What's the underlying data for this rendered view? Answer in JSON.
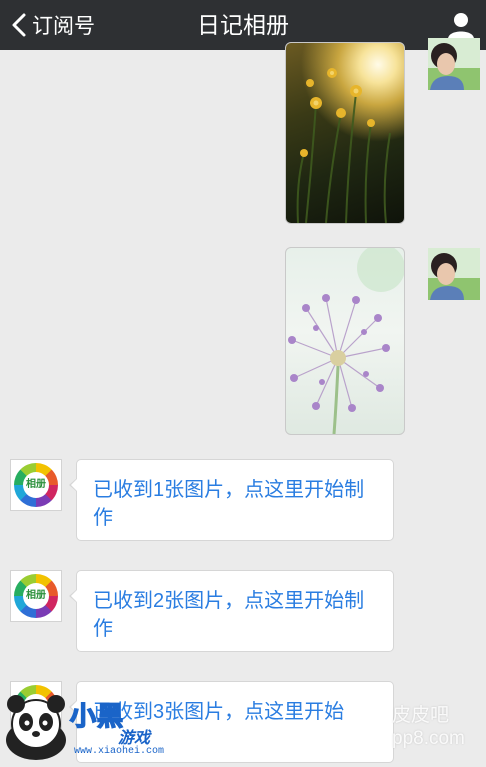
{
  "header": {
    "back_label": "订阅号",
    "title": "日记相册"
  },
  "icons": {
    "back": "chevron-left-icon",
    "profile": "person-icon",
    "app_logo": "album-logo-icon"
  },
  "messages": [
    {
      "type": "image",
      "side": "right",
      "content": "sunlit daffodils photo"
    },
    {
      "type": "image",
      "side": "right",
      "content": "purple allium flower photo"
    },
    {
      "type": "text",
      "side": "left",
      "avatar_text": "相册",
      "text": "已收到1张图片，点这里开始制作"
    },
    {
      "type": "text",
      "side": "left",
      "avatar_text": "相册",
      "text": "已收到2张图片，点这里开始制作"
    },
    {
      "type": "text",
      "side": "left",
      "avatar_text": "相册",
      "text": "已收到3张图片，点这里开始"
    }
  ],
  "watermarks": {
    "site_name": "皮皮吧",
    "site_domain": "pp8.com",
    "brand_text": "小黑",
    "brand_sub": "游戏",
    "brand_url": "www.xiaohei.com"
  },
  "colors": {
    "header_bg": "#2e3033",
    "chat_bg": "#ebebeb",
    "link_text": "#2a7de1"
  }
}
